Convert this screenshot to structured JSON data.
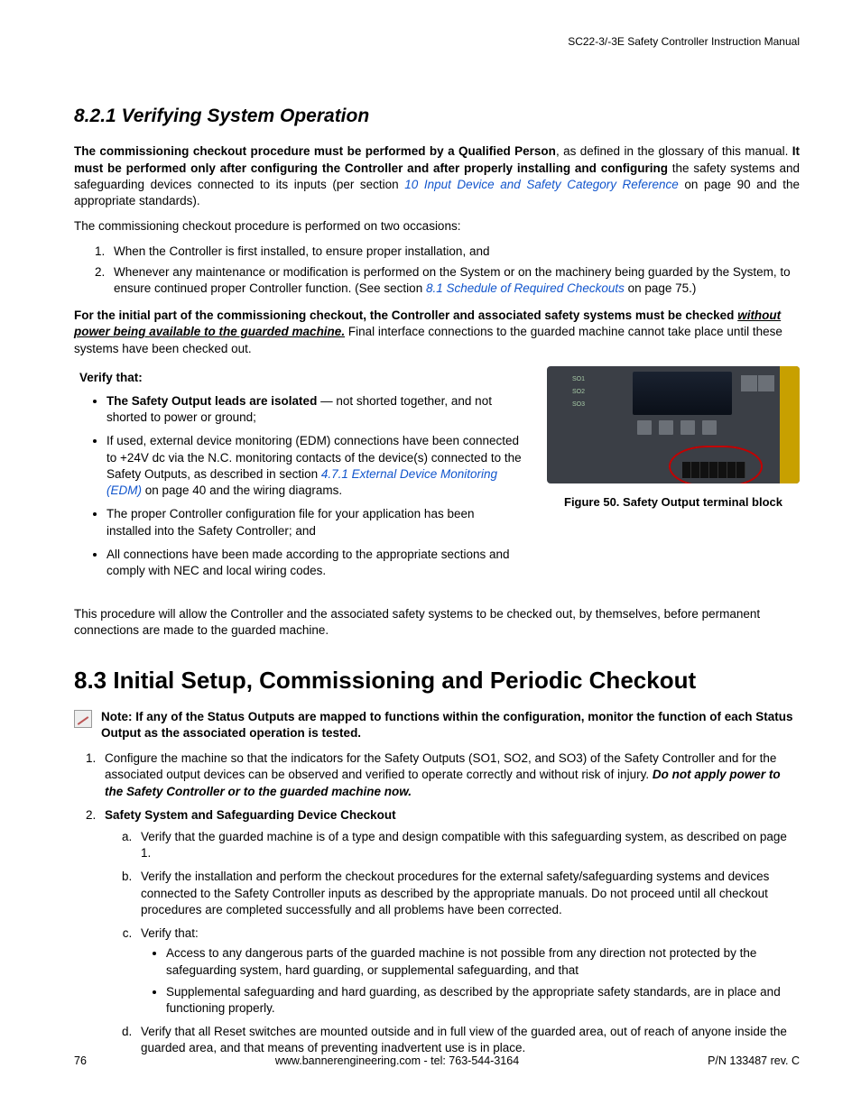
{
  "header": {
    "doc_title": "SC22-3/-3E Safety Controller Instruction Manual"
  },
  "h821": "8.2.1 Verifying System Operation",
  "p1": {
    "b1": "The commissioning checkout procedure must be performed by a Qualified Person",
    "t1": ", as defined in the glossary of this manual. ",
    "b2": "It must be performed only after configuring the Controller and after properly installing and configuring",
    "t2": " the safety systems and safeguarding devices connected to its inputs (per section ",
    "link1": "10 Input Device and Safety Category Reference",
    "t3": " on page 90 and the appropriate standards)."
  },
  "p2": "The commissioning checkout procedure is performed on two occasions:",
  "ol1": {
    "i1": "When the Controller is first installed, to ensure proper installation, and",
    "i2a": "Whenever any maintenance or modification is performed on the System or on the machinery being guarded by the System, to ensure continued proper Controller function. (See section ",
    "i2link": "8.1 Schedule of Required Checkouts",
    "i2b": " on page 75.)"
  },
  "p3": {
    "b1": "For the initial part of the commissioning checkout, the Controller and associated safety systems must be checked ",
    "u1": "without power being available to the guarded machine.",
    "t1": " Final interface connections to the guarded machine cannot take place until these systems have been checked out."
  },
  "verify_head": "Verify that:",
  "verify": {
    "i1b": "The Safety Output leads are isolated",
    "i1t": " — not shorted together, and not shorted to power or ground;",
    "i2a": "If used, external device monitoring (EDM) connections have been connected to +24V dc via the N.C. monitoring contacts of the device(s) connected to the Safety Outputs, as described in section ",
    "i2link": "4.7.1 External Device Monitoring (EDM)",
    "i2b": " on page 40 and the wiring diagrams.",
    "i3": "The proper Controller configuration file for your application has been installed into the Safety Controller; and",
    "i4": "All connections have been made according to the appropriate sections and comply with NEC and local wiring codes."
  },
  "figure": {
    "so1": "SO1",
    "so2": "SO2",
    "so3": "SO3",
    "caption": "Figure 50. Safety Output terminal block"
  },
  "p4": "This procedure will allow the Controller and the associated safety systems to be checked out, by themselves, before permanent connections are made to the guarded machine.",
  "h83": "8.3 Initial Setup, Commissioning and Periodic Checkout",
  "note": "Note: If any of the Status Outputs are mapped to functions within the configuration, monitor the function of each Status Output as the associated operation is tested.",
  "step1": {
    "t1": "Configure the machine so that the indicators for the Safety Outputs (SO1, SO2, and SO3) of the Safety Controller and for the associated output devices can be observed and verified to operate correctly and without risk of injury. ",
    "b1": "Do not apply power to the Safety Controller or to the guarded machine now."
  },
  "step2_head": "Safety System and Safeguarding Device Checkout",
  "step2": {
    "a": "Verify that the guarded machine is of a type and design compatible with this safeguarding system, as described on page 1.",
    "b": "Verify the installation and perform the checkout procedures for the external safety/safeguarding systems and devices connected to the Safety Controller inputs as described by the appropriate manuals. Do not proceed until all checkout procedures are completed successfully and all problems have been corrected.",
    "c_head": "Verify that:",
    "c1": "Access to any dangerous parts of the guarded machine is not possible from any direction not protected by the safeguarding system, hard guarding, or supplemental safeguarding, and that",
    "c2": "Supplemental safeguarding and hard guarding, as described by the appropriate safety standards, are in place and functioning properly.",
    "d": "Verify that all Reset switches are mounted outside and in full view of the guarded area, out of reach of anyone inside the guarded area, and that means of preventing inadvertent use is in place."
  },
  "footer": {
    "page": "76",
    "mid": "www.bannerengineering.com - tel: 763-544-3164",
    "right": "P/N 133487 rev. C"
  }
}
